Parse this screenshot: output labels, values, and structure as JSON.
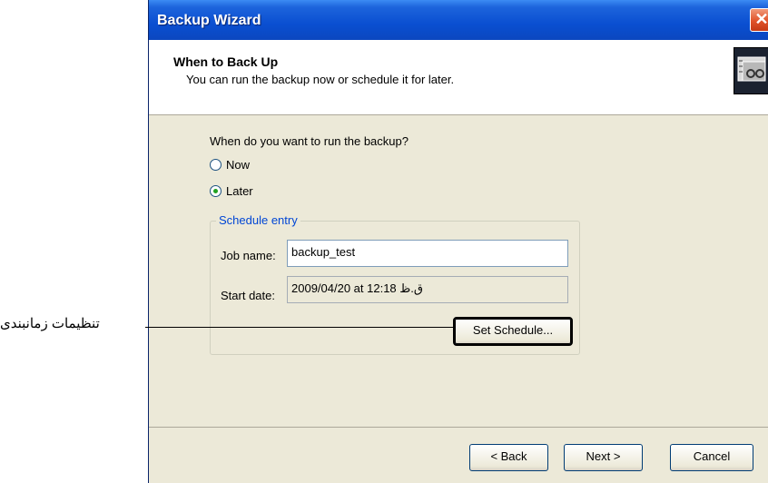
{
  "window": {
    "title": "Backup Wizard",
    "close_glyph": "✕"
  },
  "header": {
    "title": "When to Back Up",
    "subtitle": "You can run the backup now or schedule it for later.",
    "icon": "backup-schedule-icon"
  },
  "main": {
    "question": "When do you want to run the backup?",
    "options": [
      {
        "label": "Now",
        "checked": false
      },
      {
        "label": "Later",
        "checked": true
      }
    ]
  },
  "schedule": {
    "group_title": "Schedule entry",
    "job_name_label": "Job name:",
    "job_name_value": "backup_test",
    "start_date_label": "Start date:",
    "start_date_value": "2009/04/20 at 12:18 ق.ظ",
    "set_schedule_label": "Set Schedule..."
  },
  "footer": {
    "back_label": "< Back",
    "next_label": "Next >",
    "cancel_label": "Cancel"
  },
  "annotation": {
    "text": "تنظیمات زمانبندی"
  }
}
